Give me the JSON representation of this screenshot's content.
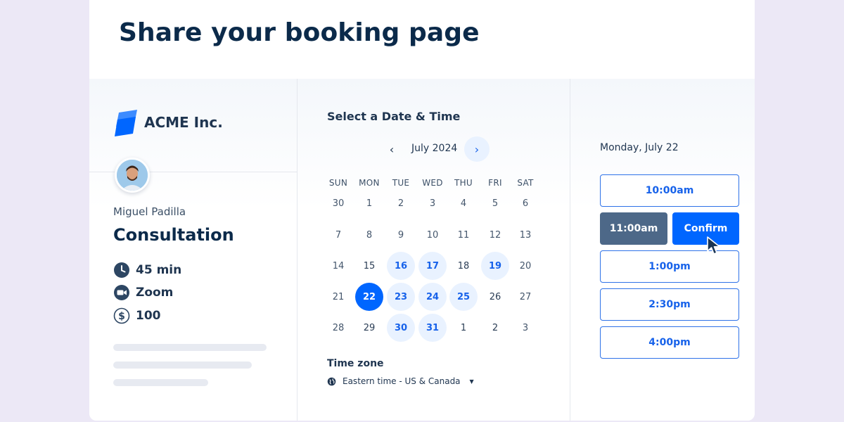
{
  "headline": "Share your booking page",
  "brand": {
    "company": "ACME Inc.",
    "logo_icon": "acme-logo-icon",
    "accent": "#0066ff"
  },
  "event": {
    "host": "Miguel Padilla",
    "title": "Consultation",
    "details": [
      {
        "icon": "clock-icon",
        "text": "45 min"
      },
      {
        "icon": "video-camera-icon",
        "text": "Zoom"
      },
      {
        "icon": "dollar-icon",
        "text": "100"
      }
    ]
  },
  "calendar": {
    "title": "Select a Date & Time",
    "month": "July 2024",
    "weekdays": [
      "SUN",
      "MON",
      "TUE",
      "WED",
      "THU",
      "FRI",
      "SAT"
    ],
    "weeks": [
      [
        {
          "d": "30",
          "s": "muted"
        },
        {
          "d": "1",
          "s": "muted"
        },
        {
          "d": "2",
          "s": "muted"
        },
        {
          "d": "3",
          "s": "muted"
        },
        {
          "d": "4",
          "s": "muted"
        },
        {
          "d": "5",
          "s": "muted"
        },
        {
          "d": "6",
          "s": "muted"
        }
      ],
      [
        {
          "d": "7",
          "s": "muted"
        },
        {
          "d": "8",
          "s": "muted"
        },
        {
          "d": "9",
          "s": "muted"
        },
        {
          "d": "10",
          "s": "muted"
        },
        {
          "d": "11",
          "s": "muted"
        },
        {
          "d": "12",
          "s": "muted"
        },
        {
          "d": "13",
          "s": "muted"
        }
      ],
      [
        {
          "d": "14",
          "s": "muted"
        },
        {
          "d": "15",
          "s": "plain"
        },
        {
          "d": "16",
          "s": "avail"
        },
        {
          "d": "17",
          "s": "avail"
        },
        {
          "d": "18",
          "s": "plain"
        },
        {
          "d": "19",
          "s": "avail"
        },
        {
          "d": "20",
          "s": "muted"
        }
      ],
      [
        {
          "d": "21",
          "s": "muted"
        },
        {
          "d": "22",
          "s": "sel"
        },
        {
          "d": "23",
          "s": "avail"
        },
        {
          "d": "24",
          "s": "avail"
        },
        {
          "d": "25",
          "s": "avail"
        },
        {
          "d": "26",
          "s": "plain"
        },
        {
          "d": "27",
          "s": "muted"
        }
      ],
      [
        {
          "d": "28",
          "s": "muted"
        },
        {
          "d": "29",
          "s": "plain"
        },
        {
          "d": "30",
          "s": "avail"
        },
        {
          "d": "31",
          "s": "avail"
        },
        {
          "d": "1",
          "s": "plain"
        },
        {
          "d": "2",
          "s": "plain"
        },
        {
          "d": "3",
          "s": "muted"
        }
      ]
    ],
    "timezone_label": "Time zone",
    "timezone_value": "Eastern time - US & Canada"
  },
  "times": {
    "date": "Monday, July 22",
    "slots": [
      "10:00am",
      "11:00am",
      "1:00pm",
      "2:30pm",
      "4:00pm"
    ],
    "selected": "11:00am",
    "confirm_label": "Confirm"
  }
}
